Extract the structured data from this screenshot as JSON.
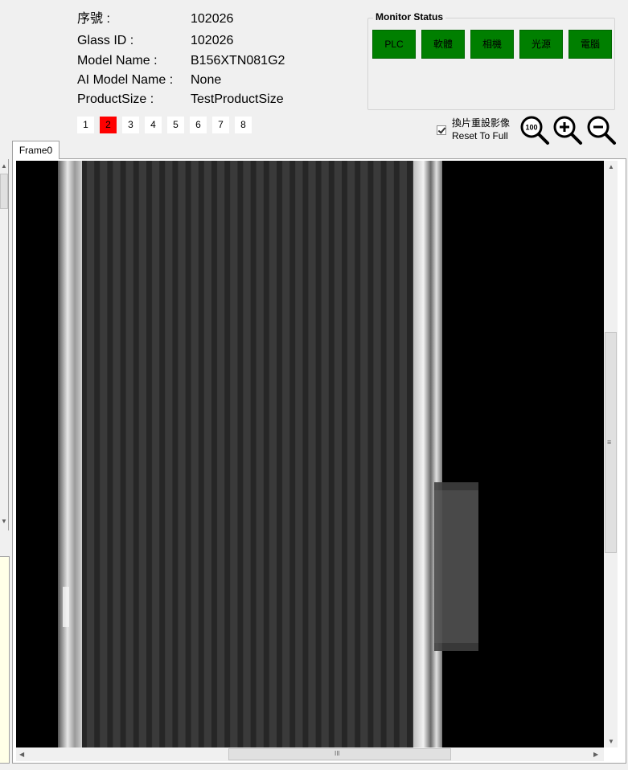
{
  "info": {
    "serial_label": "序號 :",
    "serial_value": "102026",
    "glass_id_label": "Glass ID :",
    "glass_id_value": "102026",
    "model_name_label": "Model Name :",
    "model_name_value": "B156XTN081G2",
    "ai_model_label": "AI Model Name :",
    "ai_model_value": "None",
    "product_size_label": "ProductSize :",
    "product_size_value": "TestProductSize"
  },
  "pages": {
    "items": [
      "1",
      "2",
      "3",
      "4",
      "5",
      "6",
      "7",
      "8"
    ],
    "selected": "2",
    "selected_color": "#ff0000"
  },
  "monitor": {
    "title": "Monitor Status",
    "items": [
      "PLC",
      "軟體",
      "相機",
      "光源",
      "電腦"
    ],
    "ok_color": "#007f00"
  },
  "reset": {
    "label_zh": "換片重設影像",
    "label_en": "Reset To Full",
    "checked": true
  },
  "zoom": {
    "icons": [
      "zoom-100-icon",
      "zoom-in-icon",
      "zoom-out-icon"
    ],
    "zoom_100_label": "100"
  },
  "tabs": {
    "frame0": "Frame0"
  },
  "scrollbars": {
    "h_grip": "III",
    "v_grip": "≡"
  }
}
